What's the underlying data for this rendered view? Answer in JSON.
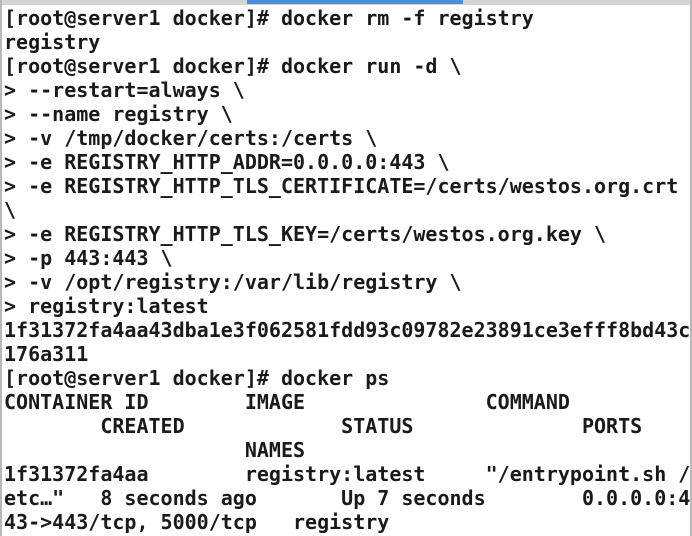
{
  "window": {
    "type": "terminal-emulator",
    "background_color": "#ffffff",
    "foreground_color": "#1a1a1a",
    "chrome_color": "#d4d4d4",
    "border_color": "#b8b8b8"
  },
  "tab_strip": {
    "active_indicator_color": "#4a90d9"
  },
  "terminal": {
    "prompt": "[root@server1 docker]#",
    "continuation_prompt": ">",
    "lines": [
      "[root@server1 docker]# docker rm -f registry",
      "registry",
      "[root@server1 docker]# docker run -d \\",
      "> --restart=always \\",
      "> --name registry \\",
      "> -v /tmp/docker/certs:/certs \\",
      "> -e REGISTRY_HTTP_ADDR=0.0.0.0:443 \\",
      "> -e REGISTRY_HTTP_TLS_CERTIFICATE=/certs/westos.org.crt",
      "\\",
      "> -e REGISTRY_HTTP_TLS_KEY=/certs/westos.org.key \\",
      "> -p 443:443 \\",
      "> -v /opt/registry:/var/lib/registry \\",
      "> registry:latest",
      "1f31372fa4aa43dba1e3f062581fdd93c09782e23891ce3efff8bd43c",
      "176a311",
      "[root@server1 docker]# docker ps",
      "CONTAINER ID        IMAGE               COMMAND",
      "        CREATED             STATUS              PORTS",
      "                    NAMES",
      "1f31372fa4aa        registry:latest     \"/entrypoint.sh /",
      "etc…\"   8 seconds ago       Up 7 seconds        0.0.0.0:4",
      "43->443/tcp, 5000/tcp   registry"
    ],
    "commands": [
      "docker rm -f registry",
      "docker run -d --restart=always --name registry -v /tmp/docker/certs:/certs -e REGISTRY_HTTP_ADDR=0.0.0.0:443 -e REGISTRY_HTTP_TLS_CERTIFICATE=/certs/westos.org.crt -e REGISTRY_HTTP_TLS_KEY=/certs/westos.org.key -p 443:443 -v /opt/registry:/var/lib/registry registry:latest",
      "docker ps"
    ],
    "container_id_full": "1f31372fa4aa43dba1e3f062581fdd93c09782e23891ce3efff8bd43c176a311",
    "ps_table": {
      "headers": [
        "CONTAINER ID",
        "IMAGE",
        "COMMAND",
        "CREATED",
        "STATUS",
        "PORTS",
        "NAMES"
      ],
      "rows": [
        {
          "container_id": "1f31372fa4aa",
          "image": "registry:latest",
          "command": "\"/entrypoint.sh /etc…\"",
          "created": "8 seconds ago",
          "status": "Up 7 seconds",
          "ports": "0.0.0.0:443->443/tcp, 5000/tcp",
          "names": "registry"
        }
      ]
    }
  }
}
